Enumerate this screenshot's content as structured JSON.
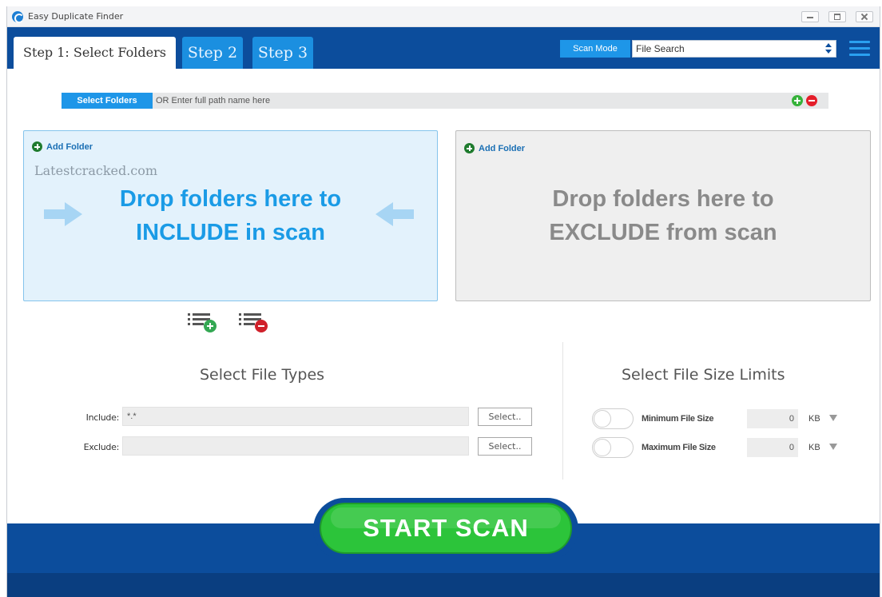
{
  "window": {
    "title": "Easy Duplicate Finder"
  },
  "tabs": [
    {
      "label": "Step 1: Select Folders",
      "active": true
    },
    {
      "label": "Step 2"
    },
    {
      "label": "Step 3"
    }
  ],
  "scan_mode": {
    "label": "Scan Mode",
    "value": "File Search"
  },
  "path_bar": {
    "button_label": "Select Folders",
    "placeholder": "OR Enter full path name here"
  },
  "include_zone": {
    "add_label": "Add Folder",
    "watermark": "Latestcracked.com",
    "line1": "Drop folders here to",
    "line2": "INCLUDE in scan"
  },
  "exclude_zone": {
    "add_label": "Add Folder",
    "line1": "Drop folders here to",
    "line2": "EXCLUDE from scan"
  },
  "file_types": {
    "title": "Select File Types",
    "include_label": "Include:",
    "include_value": "*.*",
    "exclude_label": "Exclude:",
    "exclude_value": "",
    "select_label": "Select.."
  },
  "size_limits": {
    "title": "Select File Size Limits",
    "min_label": "Minimum File Size",
    "min_value": "0",
    "max_label": "Maximum File Size",
    "max_value": "0",
    "unit": "KB"
  },
  "start_button": "START SCAN",
  "colors": {
    "header_blue": "#0c4d9c",
    "accent_blue": "#1e96e8",
    "start_green": "#2cc43a"
  }
}
